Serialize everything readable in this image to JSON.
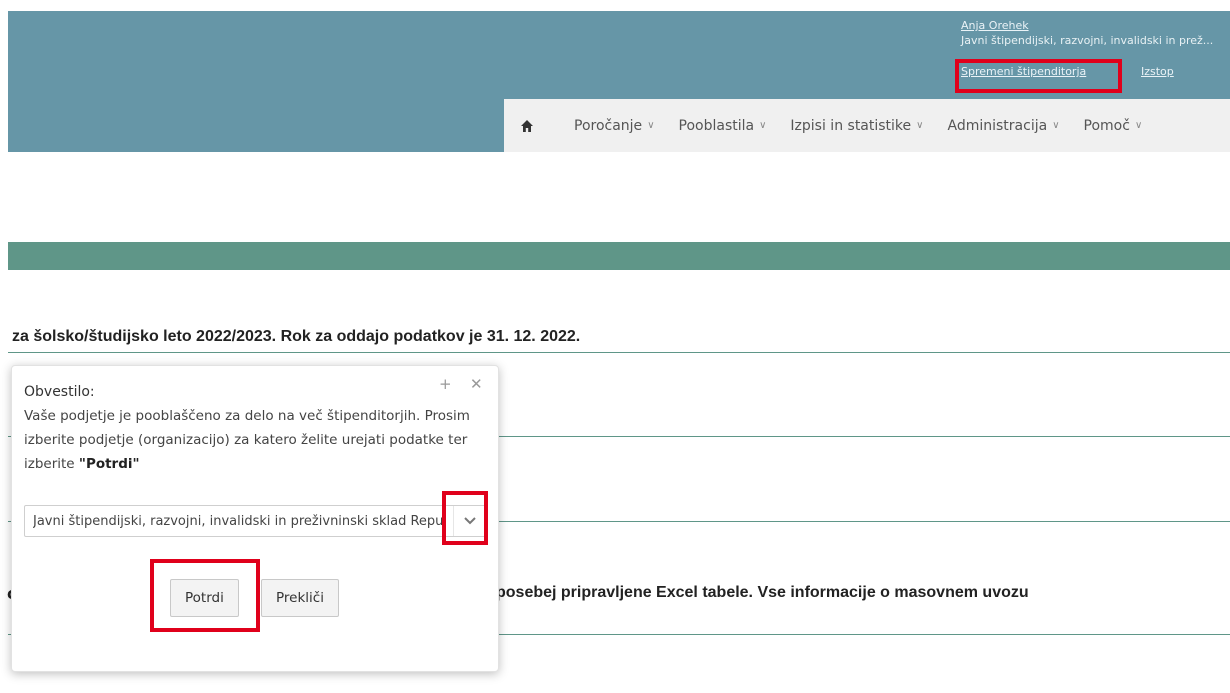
{
  "user": {
    "name": "Anja Orehek",
    "organization": "Javni štipendijski, razvojni, invalidski in prež...",
    "change_link": "Spremeni štipenditorja",
    "logout_link": "Izstop"
  },
  "nav": {
    "home_icon": "home-icon",
    "items": [
      {
        "label": "Poročanje"
      },
      {
        "label": "Pooblastila"
      },
      {
        "label": "Izpisi in statistike"
      },
      {
        "label": "Administracija"
      },
      {
        "label": "Pomoč"
      }
    ]
  },
  "background": {
    "notice_line": "za šolsko/študijsko leto 2022/2023. Rok za oddajo podatkov je 31. 12. 2022.",
    "partial_char": "o",
    "import_line": "posebej pripravljene Excel tabele. Vse informacije o masovnem uvozu"
  },
  "dialog": {
    "title": "Obvestilo:",
    "message_before": "Vaše podjetje je pooblaščeno za delo na več štipenditorjih. Prosim izberite podjetje (organizacijo) za katero želite urejati podatke ter izberite ",
    "message_bold": "\"Potrdi\"",
    "select_value": "Javni štipendijski, razvojni, invalidski in preživninski sklad Republike Slovenije",
    "confirm_label": "Potrdi",
    "cancel_label": "Prekliči",
    "icons": {
      "expand": "plus-icon",
      "close": "close-icon",
      "dropdown": "chevron-down-icon"
    }
  },
  "colors": {
    "header": "#6696a7",
    "band": "#5f9688",
    "highlight": "#e0001b"
  }
}
